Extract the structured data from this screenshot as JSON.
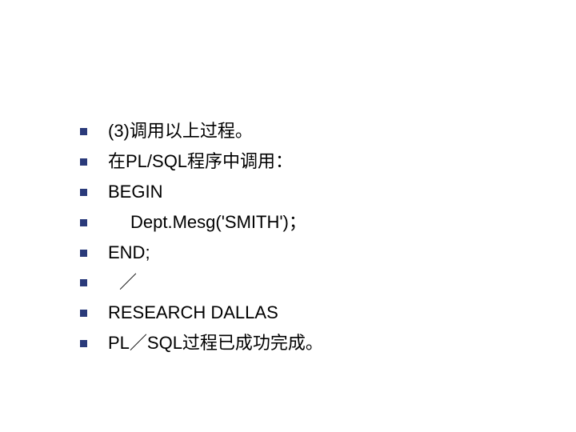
{
  "bullets": [
    {
      "text": "(3)调用以上过程。",
      "indent": ""
    },
    {
      "text": "在PL/SQL程序中调用：",
      "indent": ""
    },
    {
      "text": "BEGIN",
      "indent": ""
    },
    {
      "text": "Dept.Mesg('SMITH')；",
      "indent": "indent"
    },
    {
      "text": "END;",
      "indent": ""
    },
    {
      "text": "／",
      "indent": "indent-small"
    },
    {
      "text": "RESEARCH DALLAS",
      "indent": ""
    },
    {
      "text": "PL／SQL过程已成功完成。",
      "indent": ""
    }
  ]
}
